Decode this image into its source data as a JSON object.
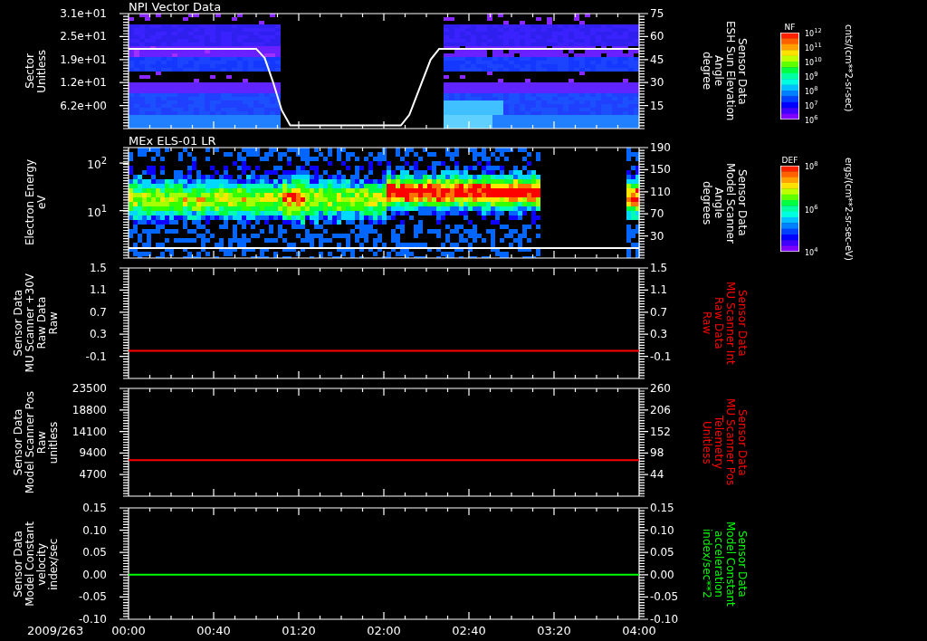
{
  "panels": [
    {
      "kind": "spectrogram",
      "title": "NPI Vector Data",
      "left_label": "Sector\nUnitless",
      "left_ticks": [
        "3.1e+01",
        "2.5e+01",
        "1.9e+01",
        "1.2e+01",
        "6.2e+00"
      ],
      "chart_data": {
        "type": "line",
        "x": [
          0,
          60,
          64,
          68,
          72,
          76,
          128,
          132,
          137,
          142,
          146,
          240
        ],
        "xlim": [
          0,
          240
        ],
        "ylim": [
          0,
          75
        ],
        "yticks": [
          {
            "value": 75,
            "label": "75"
          },
          {
            "value": 60,
            "label": "60"
          },
          {
            "value": 45,
            "label": "45"
          },
          {
            "value": 30,
            "label": "30"
          },
          {
            "value": 15,
            "label": "15"
          }
        ],
        "series": [
          {
            "name": "Sensor Data\nESH Sun Elevation\nAngle\ndegree",
            "color": "#ffffff",
            "values": [
              52,
              52,
              46,
              30,
              12,
              2,
              2,
              9,
              27,
              45,
              52,
              52
            ]
          }
        ]
      },
      "colorbar": {
        "title": "NF",
        "ticks": [
          "10$^{12}$",
          "10$^{11}$",
          "10$^{10}$",
          "10$^{9}$",
          "10$^{8}$",
          "10$^{7}$",
          "10$^{6}$"
        ],
        "units": "cnts/(cm**2-sr-sec)"
      }
    },
    {
      "kind": "spectrogram",
      "title": "MEx ELS-01 LR",
      "left_label": "Electron Energy\neV",
      "left_ticks": [
        "10$^{2}$",
        "10$^{1}$"
      ],
      "chart_data": {
        "type": "line",
        "x": [
          0,
          240
        ],
        "xlim": [
          0,
          240
        ],
        "ylim": [
          -10,
          190
        ],
        "yticks": [
          {
            "value": 190,
            "label": "190"
          },
          {
            "value": 150,
            "label": "150"
          },
          {
            "value": 110,
            "label": "110"
          },
          {
            "value": 70,
            "label": "70"
          },
          {
            "value": 30,
            "label": "30"
          }
        ],
        "series": [
          {
            "name": "Sensor Data\nModel Scanner\nAngle\ndegrees",
            "color": "#ffffff",
            "values": [
              8,
              8
            ]
          }
        ]
      },
      "colorbar": {
        "title": "DEF",
        "ticks": [
          "10$^{8}$",
          "10$^{6}$",
          "10$^{4}$"
        ],
        "units": "ergs/(cm**2-sr-sec-eV)"
      }
    },
    {
      "kind": "line",
      "left_label": "Sensor Data\nMU Scanner +30V\nRaw Data\nRaw",
      "left_ticks": [
        "1.5",
        "1.1",
        "0.7",
        "0.3",
        "-0.1"
      ],
      "chart_data": {
        "type": "line",
        "x": [
          0,
          240
        ],
        "xlim": [
          0,
          240
        ],
        "ylim": [
          -0.5,
          1.5
        ],
        "yticks": [
          {
            "value": 1.5,
            "label": "1.5"
          },
          {
            "value": 1.1,
            "label": "1.1"
          },
          {
            "value": 0.7,
            "label": "0.7"
          },
          {
            "value": 0.3,
            "label": "0.3"
          },
          {
            "value": -0.1,
            "label": "-0.1"
          }
        ],
        "series": [
          {
            "name": "Sensor Data\nMU Scanner Int\nRaw Data\nRaw",
            "color": "#ff0000",
            "values": [
              0,
              0
            ]
          }
        ]
      }
    },
    {
      "kind": "line",
      "left_label": "Sensor Data\nModel Scanner Pos\nRaw\nunitless",
      "left_ticks": [
        "23500",
        "18800",
        "14100",
        "9400",
        "4700"
      ],
      "chart_data": {
        "type": "line",
        "x": [
          0,
          240
        ],
        "xlim": [
          0,
          240
        ],
        "ylim": [
          -10,
          260
        ],
        "yticks": [
          {
            "value": 260,
            "label": "260"
          },
          {
            "value": 206,
            "label": "206"
          },
          {
            "value": 152,
            "label": "152"
          },
          {
            "value": 98,
            "label": "98"
          },
          {
            "value": 44,
            "label": "44"
          }
        ],
        "series": [
          {
            "name": "Sensor Data\nMU Scanner Pos\nTelemetry\nUnitless",
            "color": "#ff0000",
            "values": [
              80,
              80
            ]
          }
        ]
      }
    },
    {
      "kind": "line",
      "left_label": "Sensor Data\nModel Constant\nvelocity\nindex/sec",
      "left_ticks": [
        "0.15",
        "0.10",
        "0.05",
        "0.00",
        "-0.05",
        "-0.10"
      ],
      "chart_data": {
        "type": "line",
        "x": [
          0,
          240
        ],
        "xlim": [
          0,
          240
        ],
        "ylim": [
          -0.1,
          0.15
        ],
        "yticks": [
          {
            "value": 0.15,
            "label": "0.15"
          },
          {
            "value": 0.1,
            "label": "0.10"
          },
          {
            "value": 0.05,
            "label": "0.05"
          },
          {
            "value": 0,
            "label": "0.00"
          },
          {
            "value": -0.05,
            "label": "-0.05"
          },
          {
            "value": -0.1,
            "label": "-0.10"
          }
        ],
        "xticks": [
          {
            "value": 0,
            "label": "00:00"
          },
          {
            "value": 40,
            "label": "00:40"
          },
          {
            "value": 80,
            "label": "01:20"
          },
          {
            "value": 120,
            "label": "02:00"
          },
          {
            "value": 160,
            "label": "02:40"
          },
          {
            "value": 200,
            "label": "03:20"
          },
          {
            "value": 240,
            "label": "04:00"
          }
        ],
        "series": [
          {
            "name": "Sensor Data\nModel Constant\nacceleration\nindex/sec**2",
            "color": "#00ff00",
            "values": [
              0,
              0
            ]
          }
        ]
      }
    }
  ],
  "date": "2009/263"
}
